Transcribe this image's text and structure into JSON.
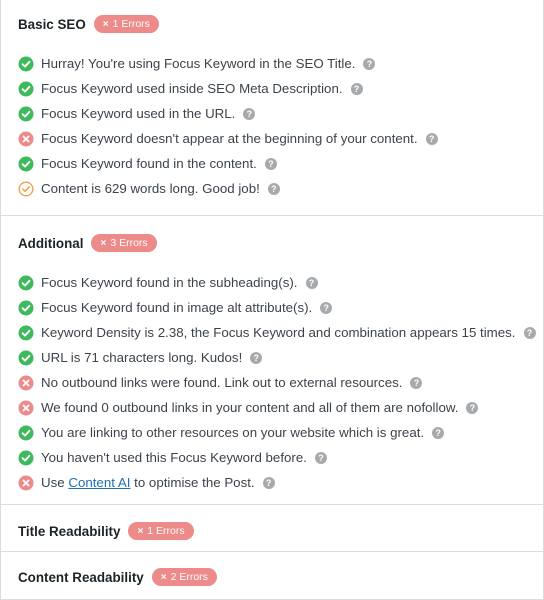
{
  "sections": {
    "basic": {
      "title": "Basic SEO",
      "badge": "1 Errors",
      "items": [
        {
          "text": "Hurray! You're using Focus Keyword in the SEO Title.",
          "status": "pass"
        },
        {
          "text": "Focus Keyword used inside SEO Meta Description.",
          "status": "pass"
        },
        {
          "text": "Focus Keyword used in the URL.",
          "status": "pass"
        },
        {
          "text": "Focus Keyword doesn't appear at the beginning of your content.",
          "status": "fail"
        },
        {
          "text": "Focus Keyword found in the content.",
          "status": "pass"
        },
        {
          "text": "Content is 629 words long. Good job!",
          "status": "warn"
        }
      ]
    },
    "additional": {
      "title": "Additional",
      "badge": "3 Errors",
      "items": [
        {
          "text": "Focus Keyword found in the subheading(s).",
          "status": "pass"
        },
        {
          "text": "Focus Keyword found in image alt attribute(s).",
          "status": "pass"
        },
        {
          "text": "Keyword Density is 2.38, the Focus Keyword and combination appears 15 times.",
          "status": "pass"
        },
        {
          "text": "URL is 71 characters long. Kudos!",
          "status": "pass"
        },
        {
          "text": "No outbound links were found. Link out to external resources.",
          "status": "fail"
        },
        {
          "text": "We found 0 outbound links in your content and all of them are nofollow.",
          "status": "fail"
        },
        {
          "text": "You are linking to other resources on your website which is great.",
          "status": "pass"
        },
        {
          "text": "You haven't used this Focus Keyword before.",
          "status": "pass"
        },
        {
          "text_before": "Use ",
          "link": "Content AI",
          "text_after": " to optimise the Post.",
          "status": "fail"
        }
      ]
    },
    "title_readability": {
      "title": "Title Readability",
      "badge": "1 Errors"
    },
    "content_readability": {
      "title": "Content Readability",
      "badge": "2 Errors"
    }
  },
  "badge_icon": "×",
  "help_icon_glyph": "?",
  "colors": {
    "pass": "#3fb95c",
    "fail": "#ed8a8a",
    "warn": "#f0a24e",
    "badge": "#ed8a8a",
    "link": "#2271b1",
    "help": "#a7aaad"
  },
  "icons": {
    "pass": "check-circle-icon",
    "fail": "x-circle-icon",
    "warn": "check-circle-outline-icon",
    "help": "question-circle-icon"
  }
}
